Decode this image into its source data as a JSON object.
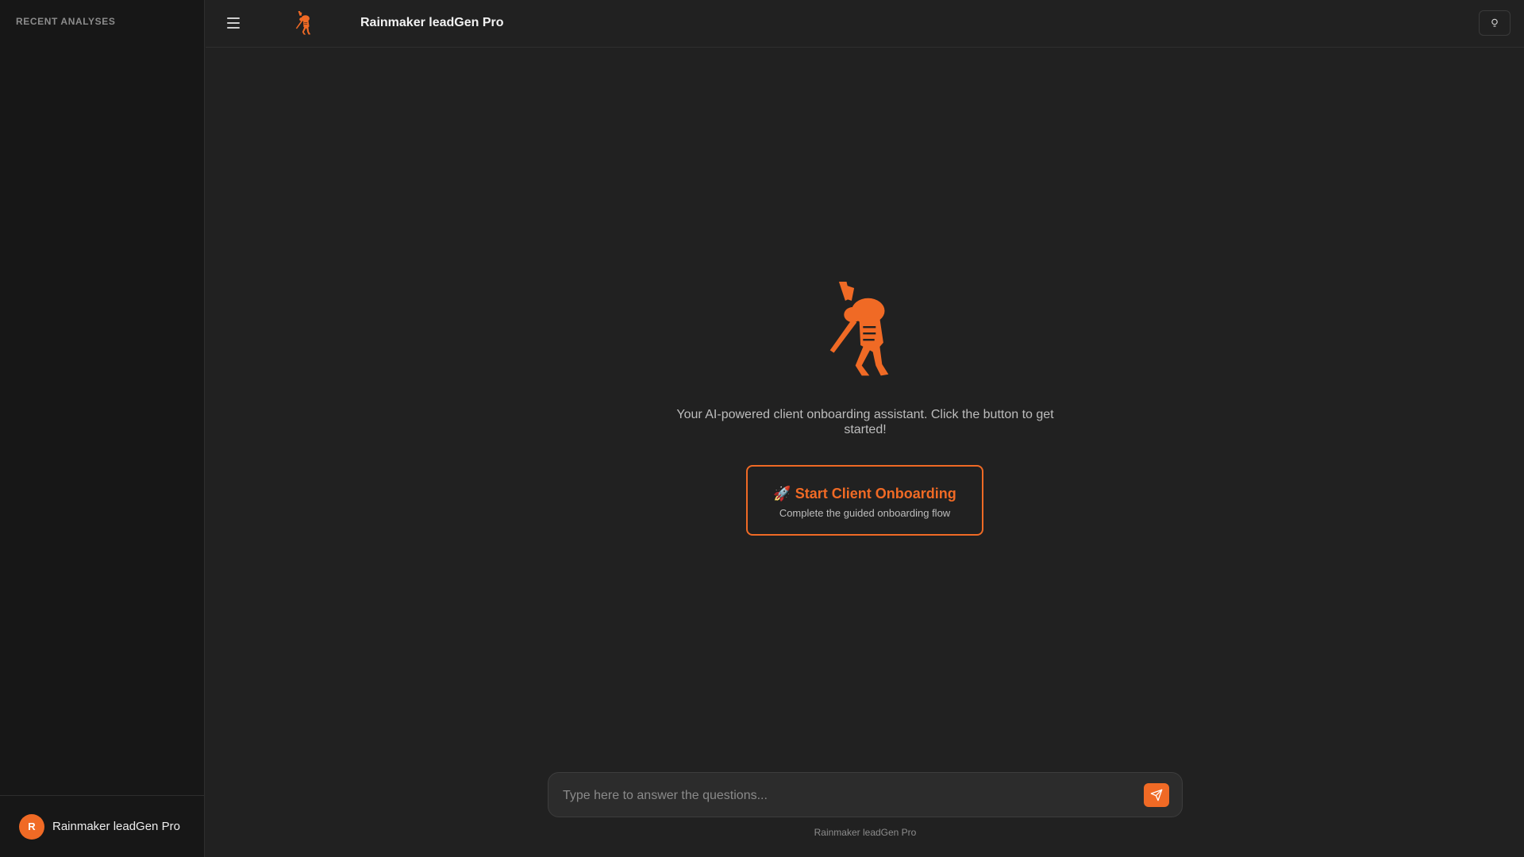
{
  "app": {
    "title": "Rainmaker leadGen Pro"
  },
  "colors": {
    "accent": "#f06a25",
    "background": "#212121",
    "sidebar": "#171717"
  },
  "sidebar": {
    "heading": "RECENT ANALYSES",
    "user": {
      "initial": "R",
      "name": "Rainmaker leadGen Pro"
    }
  },
  "header": {
    "menu_icon": "hamburger-menu-icon",
    "logo_icon": "kokopelli-logo-icon",
    "title": "Rainmaker leadGen Pro",
    "theme_icon": "theme-toggle-icon"
  },
  "main": {
    "intro": "Your AI-powered client onboarding assistant. Click the button to get started!",
    "start_button": {
      "icon": "rocket-icon",
      "emoji": "🚀",
      "title": "Start Client Onboarding",
      "subtitle": "Complete the guided onboarding flow"
    }
  },
  "composer": {
    "placeholder": "Type here to answer the questions...",
    "value": "",
    "send_icon": "send-icon"
  },
  "footer": {
    "caption": "Rainmaker leadGen Pro"
  }
}
